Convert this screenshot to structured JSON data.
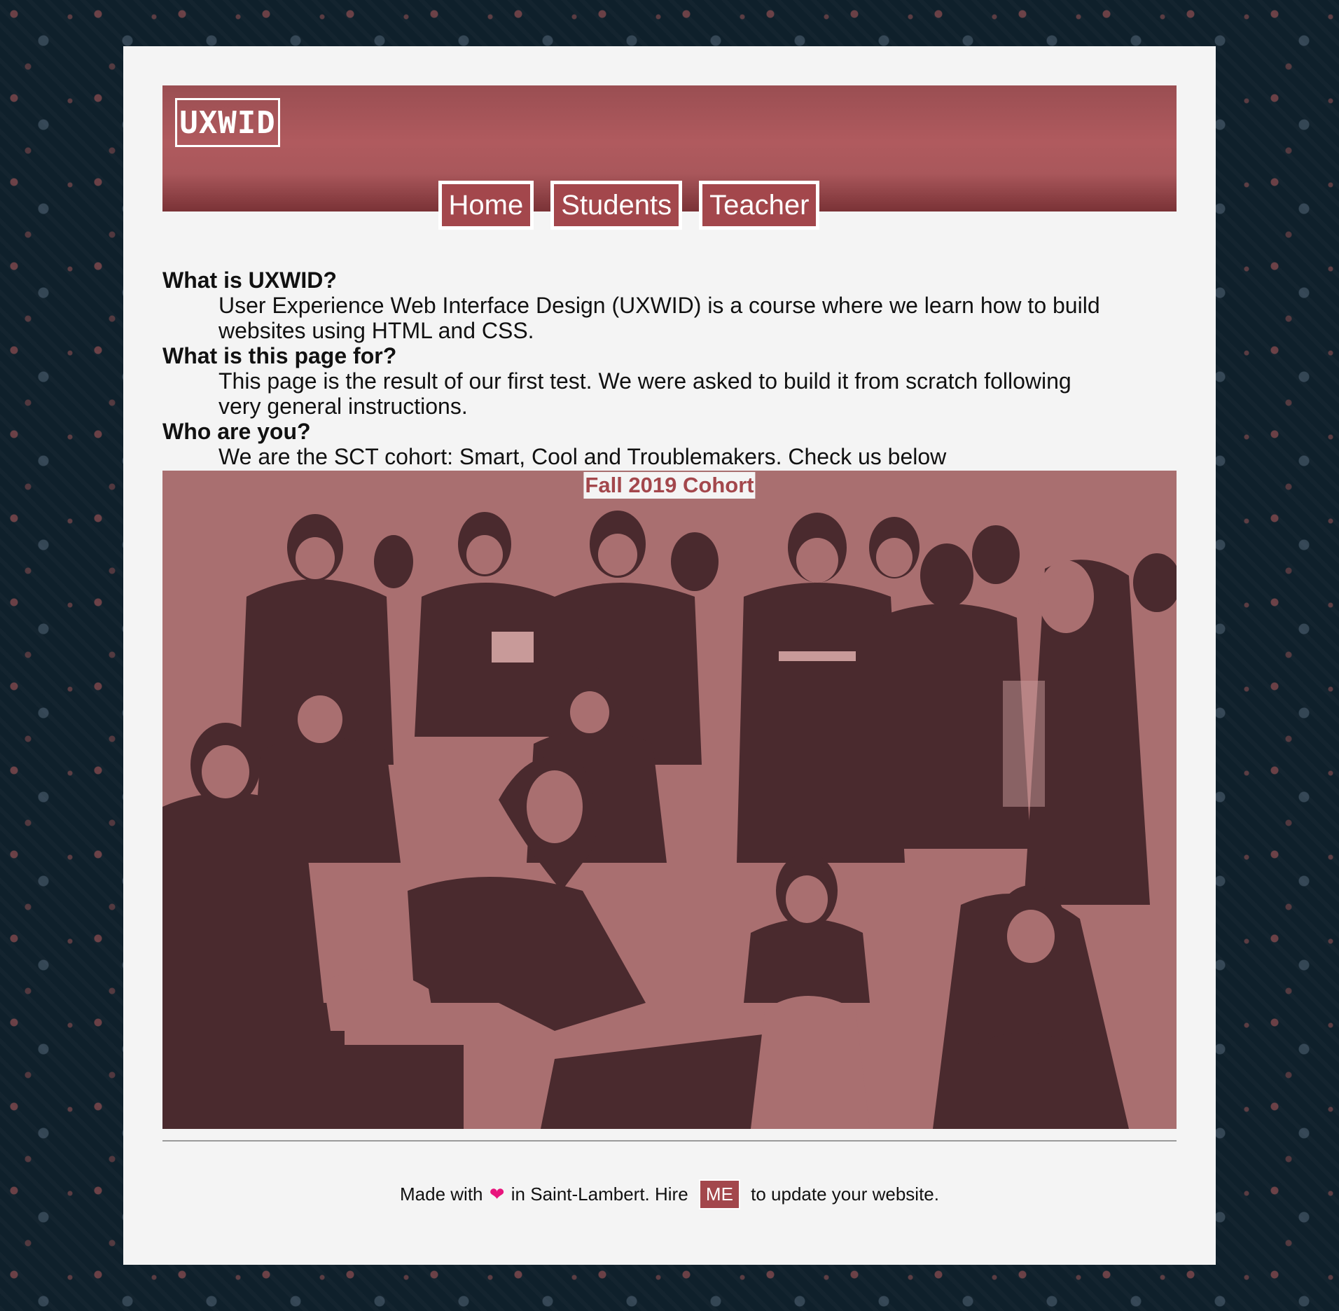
{
  "brand": {
    "logo_text": "UXWID",
    "accent_color": "#a3474c",
    "background_color": "#0f202b"
  },
  "nav": {
    "items": [
      {
        "label": "Home"
      },
      {
        "label": "Students"
      },
      {
        "label": "Teacher"
      }
    ]
  },
  "faq": [
    {
      "question": "What is UXWID?",
      "answer": "User Experience Web Interface Design (UXWID) is a course where we learn how to build websites using HTML and CSS."
    },
    {
      "question": "What is this page for?",
      "answer": "This page is the result of our first test. We were asked to build it from scratch following very general instructions."
    },
    {
      "question": "Who are you?",
      "answer": "We are the SCT cohort: Smart, Cool and Troublemakers. Check us below"
    }
  ],
  "photo": {
    "caption": "Fall 2019 Cohort"
  },
  "footer": {
    "made_with": "Made with",
    "heart_icon": "heart-icon",
    "location": "in Saint-Lambert. Hire",
    "hire_label": "ME",
    "trailing": "to update your website."
  }
}
